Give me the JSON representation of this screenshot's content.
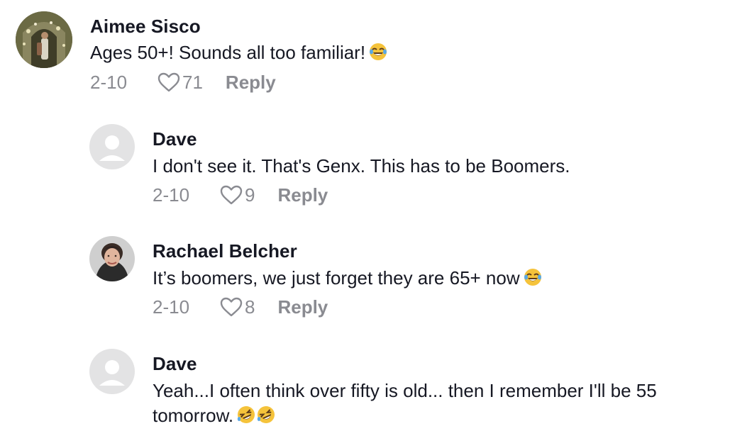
{
  "comments": [
    {
      "author": "Aimee Sisco",
      "text": "Ages 50+! Sounds all too familiar!",
      "emoji": "face-with-tears-of-joy",
      "date": "2-10",
      "likes": "71",
      "reply_label": "Reply",
      "avatar": "photo"
    },
    {
      "author": "Dave",
      "text": "I don't see it. That's Genx. This has to be Boomers.",
      "date": "2-10",
      "likes": "9",
      "reply_label": "Reply",
      "avatar": "default-user"
    },
    {
      "author": "Rachael Belcher",
      "text": "It’s boomers, we just forget they are 65+ now",
      "emoji": "face-with-tears-of-joy",
      "date": "2-10",
      "likes": "8",
      "reply_label": "Reply",
      "avatar": "photo"
    },
    {
      "author": "Dave",
      "text_line1": "Yeah...I often think over fifty is old... then I remember I'll be 55",
      "text_line2": "tomorrow.",
      "emoji": "rolling-on-the-floor-laughing x2",
      "avatar": "default-user"
    }
  ],
  "colors": {
    "text": "#161823",
    "meta": "#8a8b91",
    "avatar_placeholder": "#e3e3e4",
    "emoji_yellow": "#f5c33b"
  }
}
